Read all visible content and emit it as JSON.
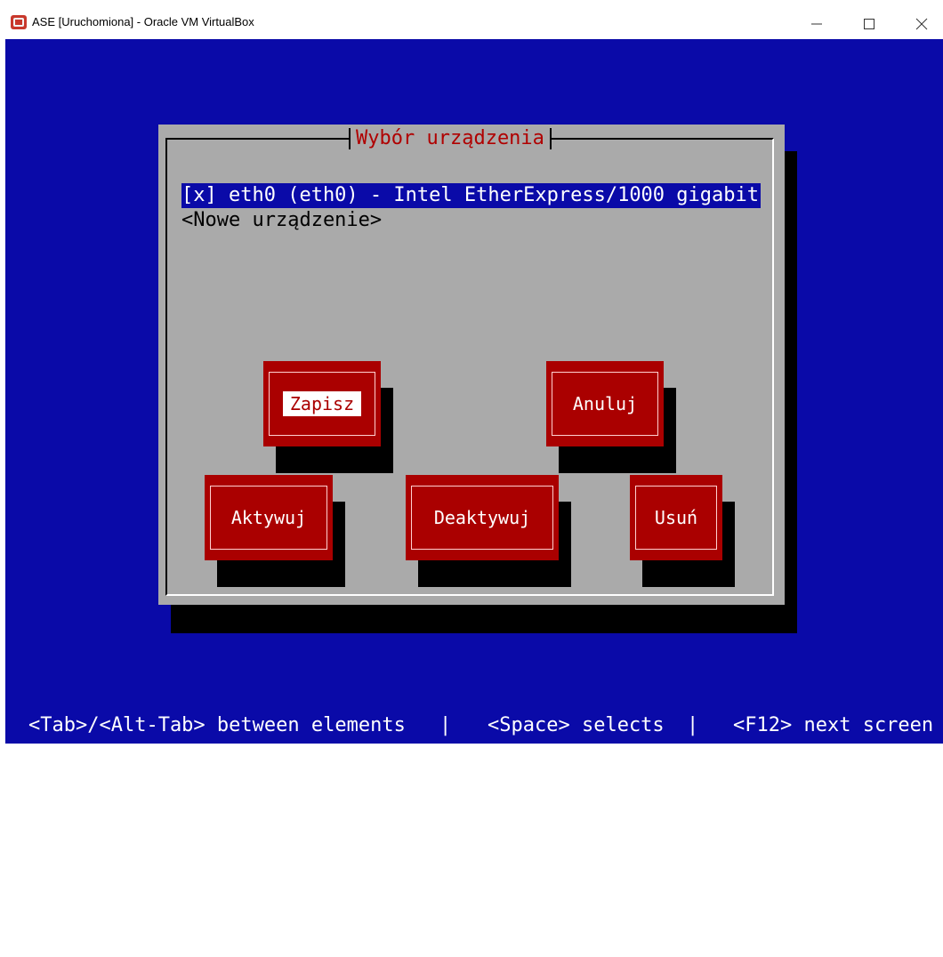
{
  "window": {
    "title": "ASE [Uruchomiona] - Oracle VM VirtualBox",
    "app_icon": "virtualbox-icon",
    "controls": [
      "minimize-icon",
      "maximize-icon",
      "close-icon"
    ]
  },
  "dialog": {
    "title": "Wybór urządzenia",
    "list": [
      {
        "label": "[x] eth0 (eth0) - Intel EtherExpress/1000 gigabit",
        "selected": true
      },
      {
        "label": "<Nowe urządzenie>",
        "selected": false
      }
    ],
    "buttons": {
      "save": "Zapisz",
      "cancel": "Anuluj",
      "activate": "Aktywuj",
      "deactivate": "Deaktywuj",
      "delete": "Usuń"
    },
    "focused_button": "Zapisz"
  },
  "statusbar": {
    "tab_hint": "<Tab>/<Alt-Tab> between elements",
    "sep1": "|",
    "space_hint": "<Space> selects",
    "sep2": "|",
    "f12_hint": "<F12> next screen"
  },
  "colors": {
    "screen_bg": "#0a0aa8",
    "dialog_bg": "#aaaaaa",
    "title_red": "#b00000",
    "button_red": "#aa0000"
  }
}
